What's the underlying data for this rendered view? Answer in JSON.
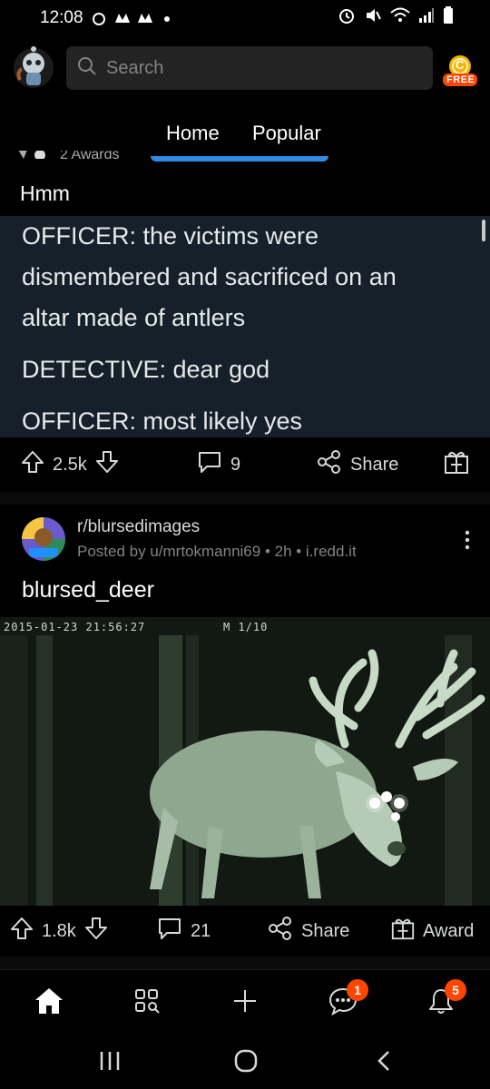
{
  "status": {
    "time": "12:08",
    "left_icons": [
      "notification-icon",
      "app-icon",
      "app-icon",
      "dot-icon"
    ],
    "right_icons": [
      "alarm-icon",
      "mute-icon",
      "wifi-icon",
      "signal-icon",
      "battery-icon"
    ]
  },
  "search": {
    "placeholder": "Search"
  },
  "coin": {
    "label": "FREE",
    "letter": "C"
  },
  "tabs": [
    {
      "label": "Home",
      "active": true
    },
    {
      "label": "Popular",
      "active": false
    }
  ],
  "post1": {
    "awards_peek": "2 Awards",
    "title": "Hmm",
    "tweet_lines": [
      "OFFICER: the victims were",
      "dismembered and sacrificed on an",
      "altar made of antlers",
      "DETECTIVE: dear god",
      "OFFICER: most likely yes"
    ],
    "upvotes": "2.5k",
    "comments": "9",
    "share_label": "Share"
  },
  "post2": {
    "subreddit": "r/blursedimages",
    "meta": "Posted by u/mrtokmanni69 • 2h • i.redd.it",
    "title": "blursed_deer",
    "cam_timestamp": "2015-01-23 21:56:27",
    "cam_frame": "M 1/10",
    "upvotes": "1.8k",
    "comments": "21",
    "share_label": "Share",
    "award_label": "Award"
  },
  "bottom_nav": {
    "items": [
      "home-icon",
      "discover-icon",
      "create-icon",
      "chat-icon",
      "notifications-icon"
    ],
    "chat_badge": "1",
    "notif_badge": "5"
  },
  "colors": {
    "accent": "#2f8ae0",
    "badge": "#ff4500",
    "tweet_bg": "#15202b",
    "nightvision": "#bfd8bf"
  }
}
